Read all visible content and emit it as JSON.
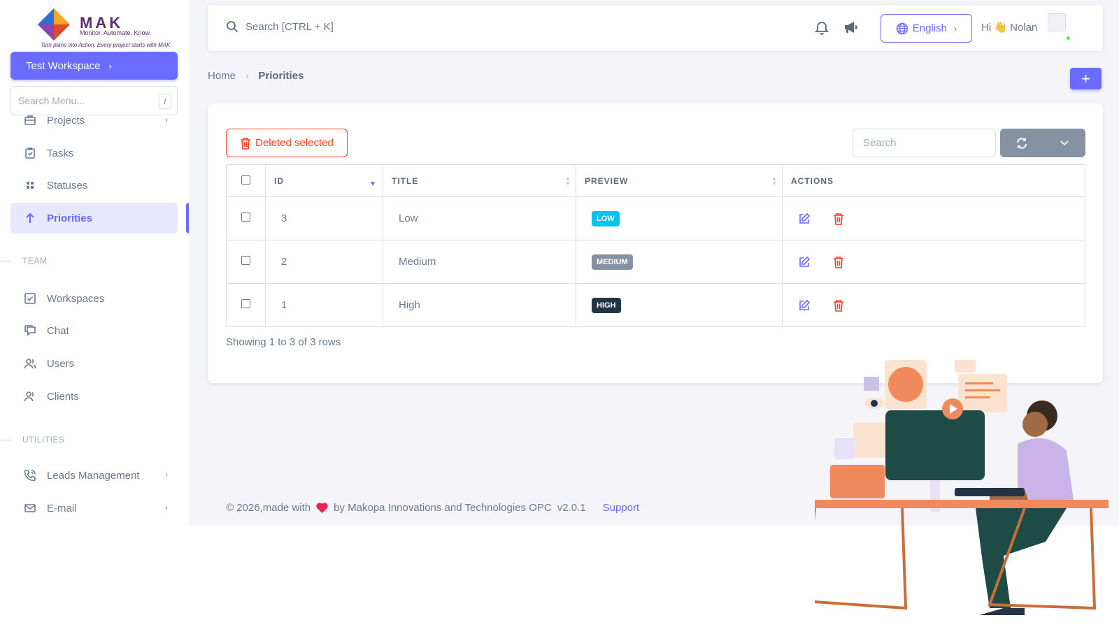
{
  "brand": {
    "name": "MAK",
    "tagline": "Monitor. Automate. Know.",
    "slogan": "Turn plans into Action. Every project starts with MAK"
  },
  "sidebar": {
    "workspace_label": "Test Workspace",
    "search_placeholder": "Search Menu...",
    "search_shortcut": "/",
    "items": [
      {
        "label": "Projects",
        "icon": "briefcase-icon",
        "has_arrow": true
      },
      {
        "label": "Tasks",
        "icon": "clipboard-check-icon"
      },
      {
        "label": "Statuses",
        "icon": "grid-dots-icon"
      },
      {
        "label": "Priorities",
        "icon": "arrow-up-icon",
        "active": true
      }
    ],
    "team_header": "TEAM",
    "team_items": [
      {
        "label": "Workspaces",
        "icon": "checkbox-square-icon"
      },
      {
        "label": "Chat",
        "icon": "chat-icon"
      },
      {
        "label": "Users",
        "icon": "users-icon"
      },
      {
        "label": "Clients",
        "icon": "clients-icon"
      }
    ],
    "utilities_header": "UTILITIES",
    "utility_items": [
      {
        "label": "Leads Management",
        "icon": "phone-call-icon",
        "has_arrow": true
      },
      {
        "label": "E-mail",
        "icon": "mail-icon",
        "has_arrow": true
      }
    ]
  },
  "navbar": {
    "search_placeholder": "Search [CTRL + K]",
    "language": "English",
    "greeting": "Hi 👋 Nolan"
  },
  "breadcrumb": {
    "home": "Home",
    "current": "Priorities"
  },
  "table": {
    "delete_selected_label": "Deleted selected",
    "search_placeholder": "Search",
    "columns": [
      "ID",
      "TITLE",
      "PREVIEW",
      "ACTIONS"
    ],
    "rows": [
      {
        "id": "3",
        "title": "Low",
        "preview": "LOW",
        "color": "#03c3ec"
      },
      {
        "id": "2",
        "title": "Medium",
        "preview": "MEDIUM",
        "color": "#8592a3"
      },
      {
        "id": "1",
        "title": "High",
        "preview": "HIGH",
        "color": "#233446"
      }
    ],
    "pagination_text": "Showing 1 to 3 of 3 rows"
  },
  "footer": {
    "copyright_before": "© 2026,made with",
    "copyright_after": "by Makopa Innovations and Technologies OPC",
    "version": "v2.0.1",
    "support_label": "Support"
  },
  "colors": {
    "primary": "#696cff",
    "danger": "#ff3e1d",
    "secondary": "#8592a3"
  }
}
